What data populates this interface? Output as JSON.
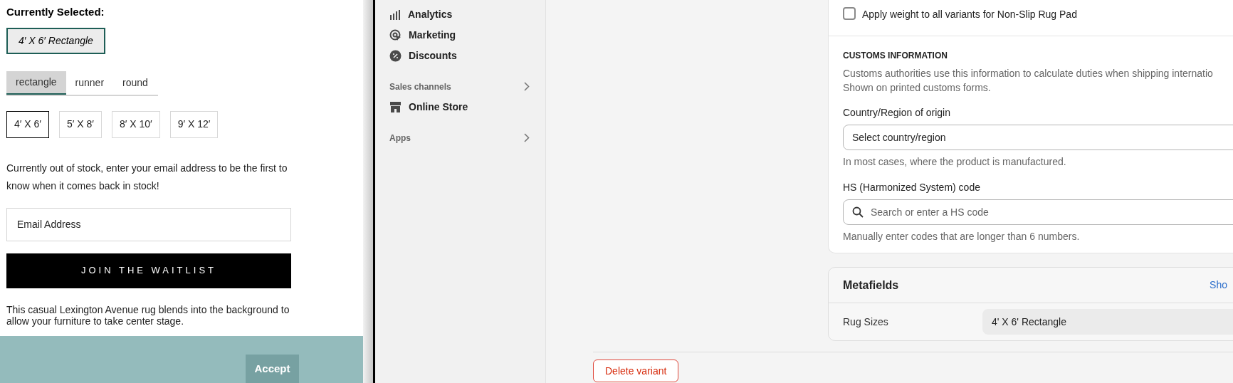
{
  "product_panel": {
    "selected_heading": "Currently Selected:",
    "selected_value": "4′ X 6′ Rectangle",
    "shape_tabs": [
      {
        "label": "rectangle",
        "selected": true
      },
      {
        "label": "runner",
        "selected": false
      },
      {
        "label": "round",
        "selected": false
      }
    ],
    "sizes": [
      {
        "label": "4′ X 6′",
        "selected": true
      },
      {
        "label": "5′ X 8′",
        "selected": false
      },
      {
        "label": "8′ X 10′",
        "selected": false
      },
      {
        "label": "9′ X 12′",
        "selected": false
      }
    ],
    "stock_message": "Currently out of stock, enter your email address to be the first to know when it comes back in stock!",
    "email_field": {
      "placeholder": "Email Address"
    },
    "waitlist_button": "JOIN THE WAITLIST",
    "description": "This casual Lexington Avenue rug blends into the background to allow your furniture to take center stage."
  },
  "cookie_bar": {
    "accept_button": "Accept"
  },
  "sidebar": {
    "items": [
      {
        "kind": "item",
        "label": "Analytics"
      },
      {
        "kind": "item",
        "label": "Marketing"
      },
      {
        "kind": "item",
        "label": "Discounts"
      },
      {
        "kind": "section",
        "label": "Sales channels"
      },
      {
        "kind": "item",
        "label": "Online Store"
      },
      {
        "kind": "section",
        "label": "Apps"
      }
    ]
  },
  "variant_form": {
    "weight_checkbox": {
      "label": "Apply weight to all variants for Non-Slip Rug Pad",
      "checked": false
    },
    "customs": {
      "heading": "CUSTOMS INFORMATION",
      "description": "Customs authorities use this information to calculate duties when shipping internatio",
      "description_2": "Shown on printed customs forms.",
      "country_label": "Country/Region of origin",
      "country_select": "Select country/region",
      "country_hint": "In most cases, where the product is manufactured.",
      "hs_label": "HS (Harmonized System) code",
      "hs_field": {
        "placeholder": "Search or enter a HS code"
      },
      "hs_hint": "Manually enter codes that are longer than 6 numbers."
    },
    "metafields": {
      "title": "Metafields",
      "link": "Sho",
      "rows": [
        {
          "label": "Rug Sizes",
          "value": "4' X 6' Rectangle"
        }
      ]
    },
    "delete_button": "Delete variant"
  }
}
